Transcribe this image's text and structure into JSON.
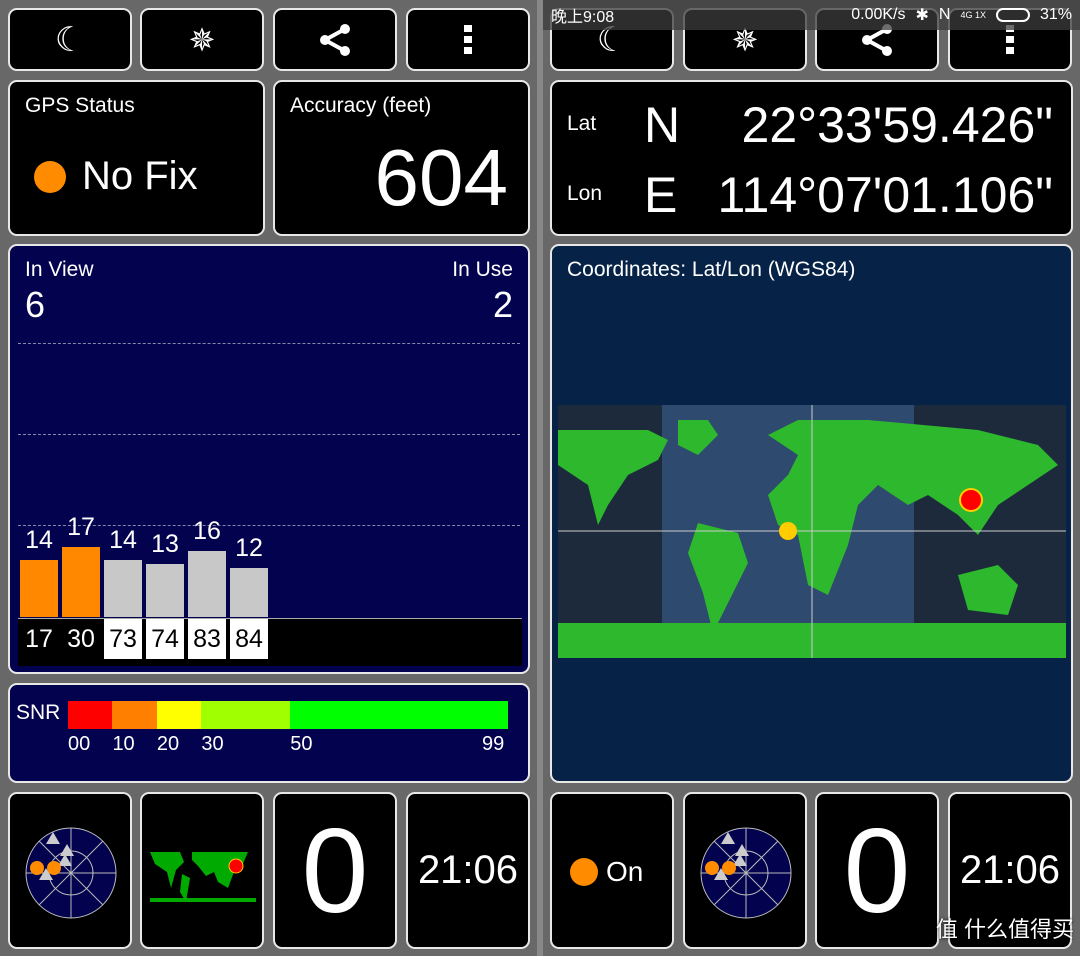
{
  "status_bar": {
    "time": "晚上9:08",
    "speed": "0.00K/s",
    "network": "4G 1X",
    "battery": "31%"
  },
  "toolbar": {
    "icons": [
      "moon-icon",
      "compass-icon",
      "share-icon",
      "more-vert-icon"
    ]
  },
  "left": {
    "gps_status": {
      "title": "GPS Status",
      "value": "No Fix",
      "dot_color": "#ff8c00"
    },
    "accuracy": {
      "title": "Accuracy (feet)",
      "value": "604"
    },
    "satellites": {
      "in_view_label": "In View",
      "in_view": "6",
      "in_use_label": "In Use",
      "in_use": "2",
      "bars": [
        {
          "snr": "14",
          "prn": "17",
          "used": true
        },
        {
          "snr": "17",
          "prn": "30",
          "used": true
        },
        {
          "snr": "14",
          "prn": "73",
          "used": false
        },
        {
          "snr": "13",
          "prn": "74",
          "used": false
        },
        {
          "snr": "16",
          "prn": "83",
          "used": false
        },
        {
          "snr": "12",
          "prn": "84",
          "used": false
        }
      ]
    },
    "snr_legend": {
      "label": "SNR",
      "ticks": [
        "00",
        "10",
        "20",
        "30",
        "50",
        "99"
      ],
      "colors": [
        "#ff0000",
        "#ff8000",
        "#ffff00",
        "#a0ff00",
        "#00ff00"
      ]
    },
    "bottom": {
      "count": "0",
      "clock": "21:06"
    }
  },
  "right": {
    "coords": {
      "lat_label": "Lat",
      "lat_hem": "N",
      "lat": "22°33'59.426\"",
      "lon_label": "Lon",
      "lon_hem": "E",
      "lon": "114°07'01.106\""
    },
    "map": {
      "title": "Coordinates: Lat/Lon (WGS84)"
    },
    "bottom": {
      "gps_state": "On",
      "count": "0",
      "clock": "21:06"
    },
    "watermark": "值 什么值得买"
  }
}
